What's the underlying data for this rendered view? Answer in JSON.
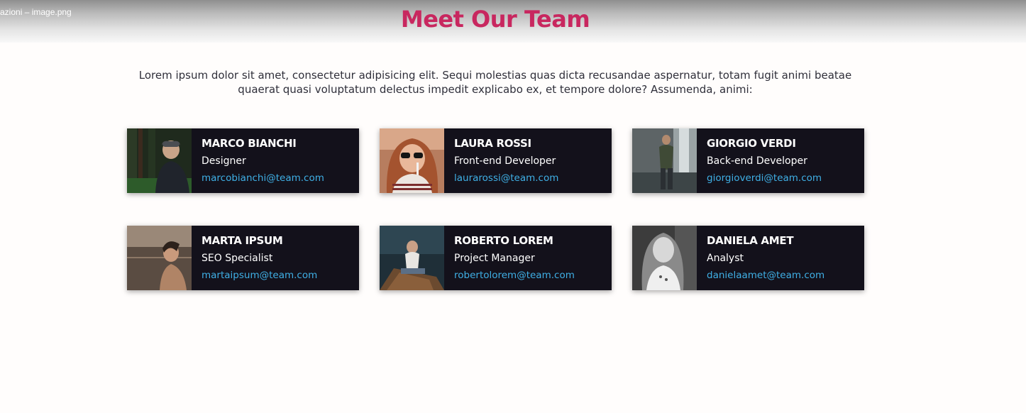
{
  "window": {
    "title": "azioni  – image.png"
  },
  "header": {
    "title": "Meet Our Team"
  },
  "intro": "Lorem ipsum dolor sit amet, consectetur adipisicing elit. Sequi molestias quas dicta recusandae aspernatur, totam fugit animi beatae quaerat quasi voluptatum delectus impedit explicabo ex, et tempore dolore? Assumenda, animi:",
  "colors": {
    "accent": "#c8275f",
    "card_bg": "#13111b",
    "email": "#3fb0e6"
  },
  "team": [
    {
      "name": "MARCO BIANCHI",
      "role": "Designer",
      "email": "marcobianchi@team.com"
    },
    {
      "name": "LAURA ROSSI",
      "role": "Front-end Developer",
      "email": "laurarossi@team.com"
    },
    {
      "name": "GIORGIO VERDI",
      "role": "Back-end Developer",
      "email": "giorgioverdi@team.com"
    },
    {
      "name": "MARTA IPSUM",
      "role": "SEO Specialist",
      "email": "martaipsum@team.com"
    },
    {
      "name": "ROBERTO LOREM",
      "role": "Project Manager",
      "email": "robertolorem@team.com"
    },
    {
      "name": "DANIELA AMET",
      "role": "Analyst",
      "email": "danielaamet@team.com"
    }
  ]
}
